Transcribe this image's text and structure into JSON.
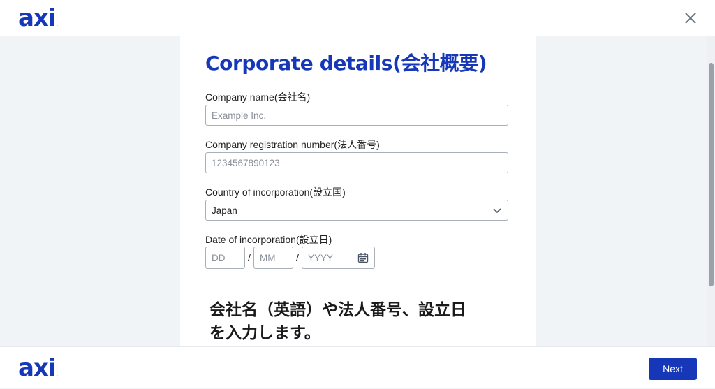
{
  "header": {
    "logo": "axi",
    "close_icon": "close-icon"
  },
  "form": {
    "title": "Corporate details(会社概要)",
    "company_name": {
      "label": "Company name(会社名)",
      "value": "",
      "placeholder": "Example Inc."
    },
    "registration_number": {
      "label": "Company registration number(法人番号)",
      "value": "",
      "placeholder": "1234567890123"
    },
    "country": {
      "label": "Country of incorporation(設立国)",
      "selected": "Japan"
    },
    "date": {
      "label": "Date of incorporation(設立日)",
      "day_placeholder": "DD",
      "month_placeholder": "MM",
      "year_placeholder": "YYYY",
      "separator": "/"
    }
  },
  "subtitle": {
    "line1": "会社名（英語）や法人番号、設立日",
    "line2": "を入力します。"
  },
  "footer": {
    "logo": "axi",
    "next_label": "Next"
  },
  "colors": {
    "brand": "#1638b8",
    "background": "#f1f4f7"
  }
}
